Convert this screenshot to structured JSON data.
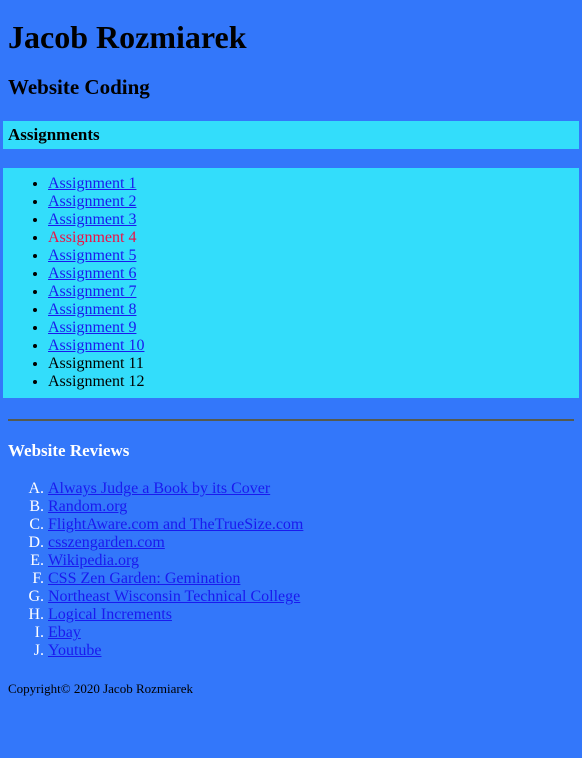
{
  "theme": {
    "background": "#3377fa",
    "panel": "#33ddfb",
    "link": "#1a1aee",
    "visited_link": "#ee1144",
    "heading_text": "#000000",
    "reviews_heading_text": "#ffffff",
    "divider": "#555a4f"
  },
  "header": {
    "title": "Jacob Rozmiarek",
    "subtitle": "Website Coding"
  },
  "assignments": {
    "section_label": "Assignments",
    "items": [
      {
        "label": "Assignment 1",
        "state": "link"
      },
      {
        "label": "Assignment 2",
        "state": "link"
      },
      {
        "label": "Assignment 3",
        "state": "link"
      },
      {
        "label": "Assignment 4",
        "state": "visited"
      },
      {
        "label": "Assignment 5",
        "state": "link"
      },
      {
        "label": "Assignment 6",
        "state": "link"
      },
      {
        "label": "Assignment 7",
        "state": "link"
      },
      {
        "label": "Assignment 8",
        "state": "link"
      },
      {
        "label": "Assignment 9",
        "state": "link"
      },
      {
        "label": "Assignment 10",
        "state": "link"
      },
      {
        "label": "Assignment 11",
        "state": "plain"
      },
      {
        "label": "Assignment 12",
        "state": "plain"
      }
    ]
  },
  "reviews": {
    "section_label": "Website Reviews",
    "markers": [
      "A.",
      "B.",
      "C.",
      "D.",
      "E.",
      "F.",
      "G.",
      "H.",
      "I.",
      "J."
    ],
    "items": [
      {
        "label": "Always Judge a Book by its Cover",
        "state": "link"
      },
      {
        "label": "Random.org",
        "state": "link"
      },
      {
        "label": "FlightAware.com and TheTrueSize.com",
        "state": "link"
      },
      {
        "label": "csszengarden.com",
        "state": "link"
      },
      {
        "label": "Wikipedia.org",
        "state": "link"
      },
      {
        "label": "CSS Zen Garden: Gemination",
        "state": "link"
      },
      {
        "label": "Northeast Wisconsin Technical College",
        "state": "link"
      },
      {
        "label": "Logical Increments",
        "state": "link"
      },
      {
        "label": "Ebay",
        "state": "link"
      },
      {
        "label": "Youtube",
        "state": "link"
      }
    ]
  },
  "footer": {
    "copyright": "Copyright© 2020 Jacob Rozmiarek"
  }
}
